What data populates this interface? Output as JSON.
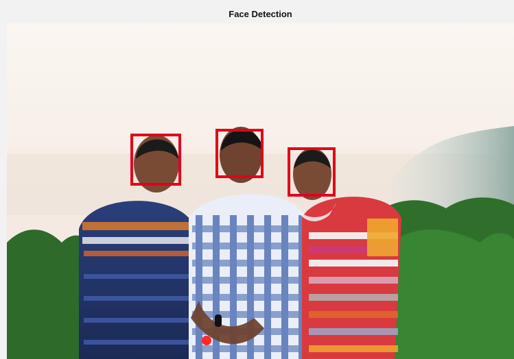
{
  "window": {
    "title": "Face Detection"
  },
  "detections": {
    "box_color": "#e3001b",
    "count_shown": 3
  },
  "photo": {
    "description_tags": [
      "three-people",
      "outdoor",
      "hills",
      "trees",
      "sky"
    ]
  }
}
